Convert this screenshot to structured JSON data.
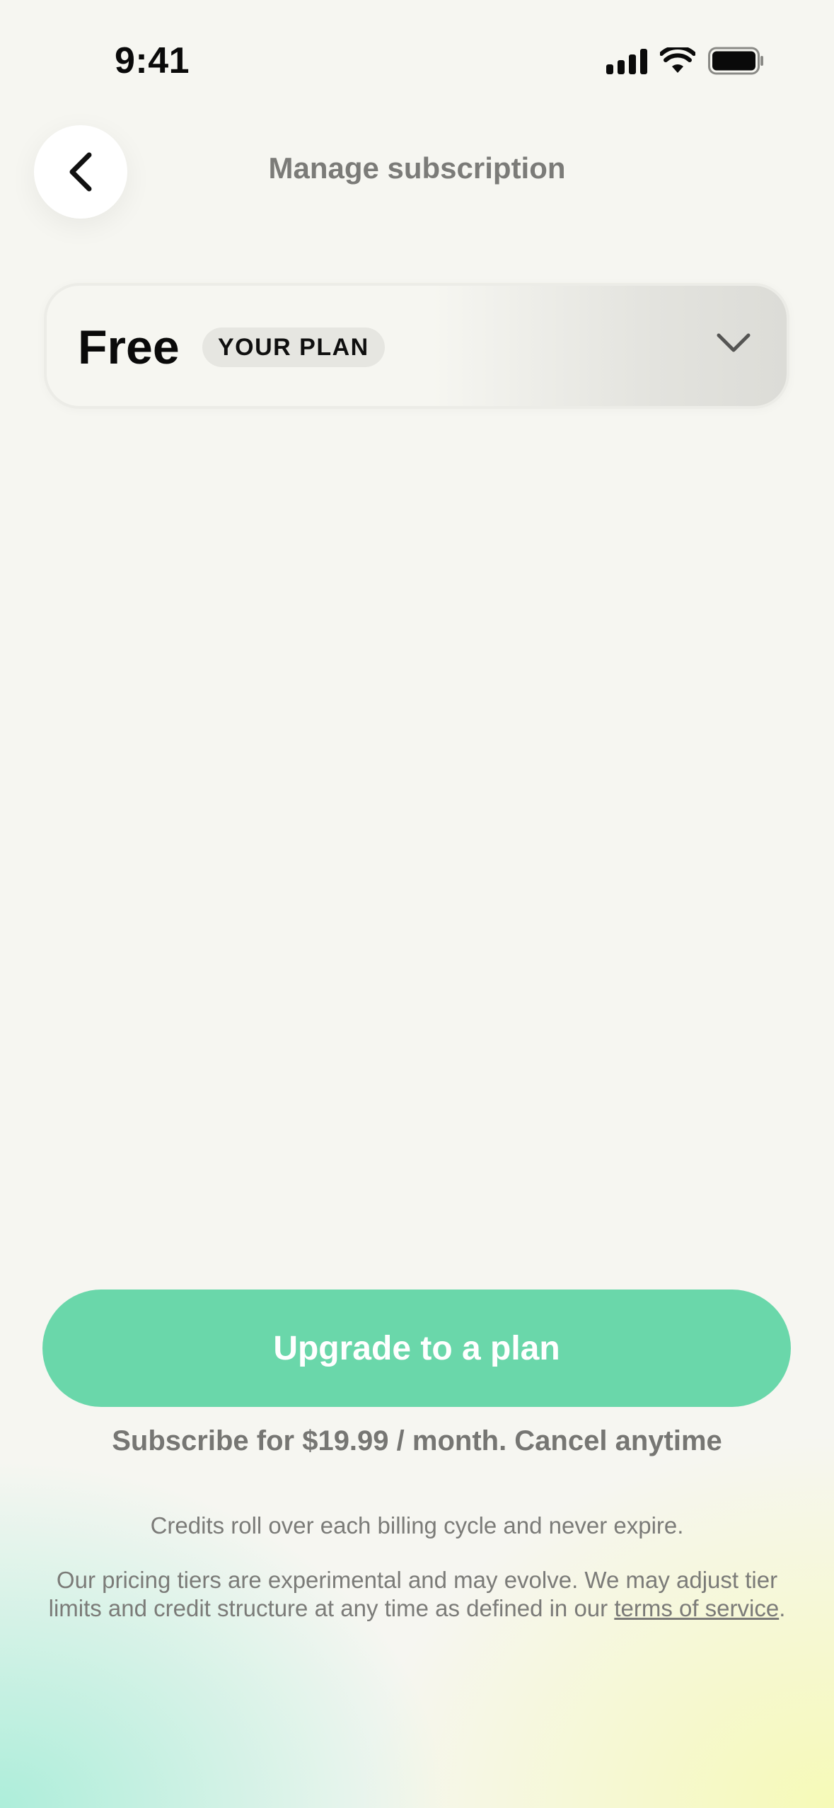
{
  "status_bar": {
    "time": "9:41",
    "icons": [
      "cellular-signal-icon",
      "wifi-icon",
      "battery-icon"
    ]
  },
  "header": {
    "back_icon": "chevron-left-icon",
    "title": "Manage subscription"
  },
  "plan": {
    "name": "Free",
    "badge": "YOUR PLAN",
    "expand_icon": "chevron-down-icon"
  },
  "footer": {
    "upgrade_label": "Upgrade to a plan",
    "subscribe_text": "Subscribe for $19.99 / month. Cancel anytime",
    "credits_note": "Credits roll over each billing cycle and never expire.",
    "disclaimer_prefix": "Our pricing tiers are experimental and may evolve. We may adjust tier limits and credit structure at any time as defined in our ",
    "terms_link": "terms of service",
    "disclaimer_suffix": "."
  },
  "colors": {
    "accent": "#6ad7aa",
    "background": "#f6f6f1",
    "muted_text": "#7b7b78"
  }
}
